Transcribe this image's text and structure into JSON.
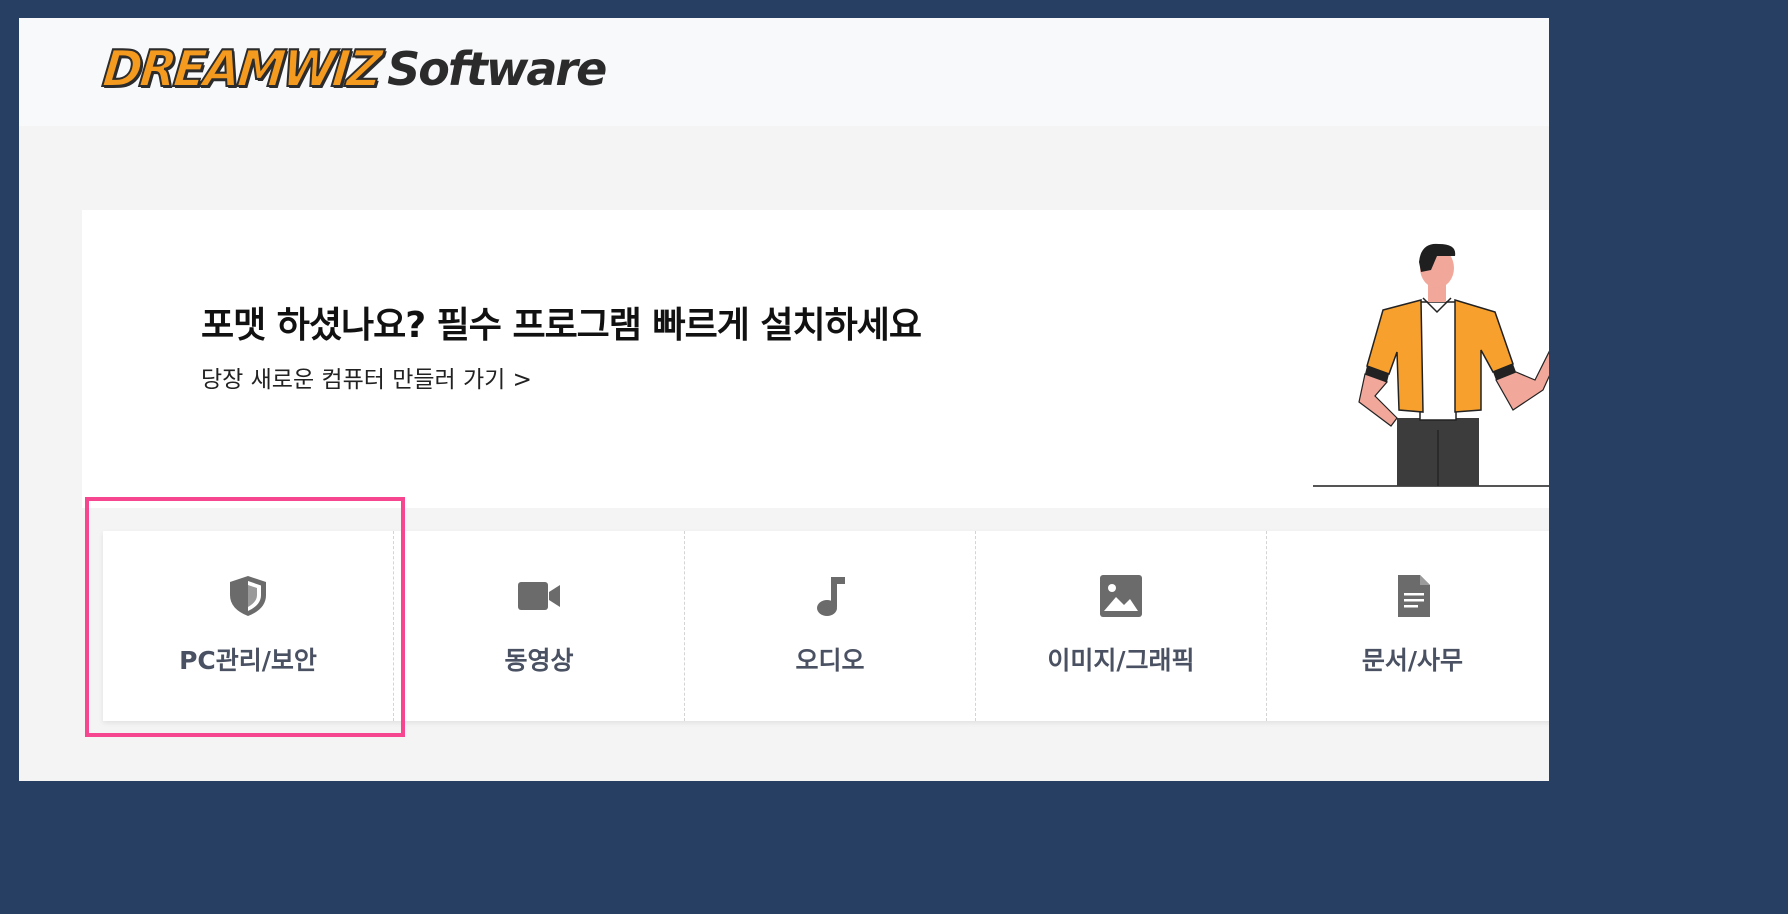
{
  "header": {
    "logo_part1": "DREAMWIZ",
    "logo_part2": "Software"
  },
  "banner": {
    "title": "포맷 하셨나요? 필수 프로그램 빠르게 설치하세요",
    "link_text": "당장 새로운 컴퓨터 만들러 가기 >"
  },
  "categories": [
    {
      "label": "PC관리/보안",
      "icon": "shield-icon"
    },
    {
      "label": "동영상",
      "icon": "video-camera-icon"
    },
    {
      "label": "오디오",
      "icon": "music-note-icon"
    },
    {
      "label": "이미지/그래픽",
      "icon": "image-icon"
    },
    {
      "label": "문서/사무",
      "icon": "document-icon"
    }
  ],
  "colors": {
    "outer_border": "#263f63",
    "logo_orange": "#f39a1f",
    "highlight_pink": "#f5468f",
    "category_text": "#4a5162",
    "icon_gray": "#6b6b6b",
    "shirt_orange": "#f7a02d"
  }
}
